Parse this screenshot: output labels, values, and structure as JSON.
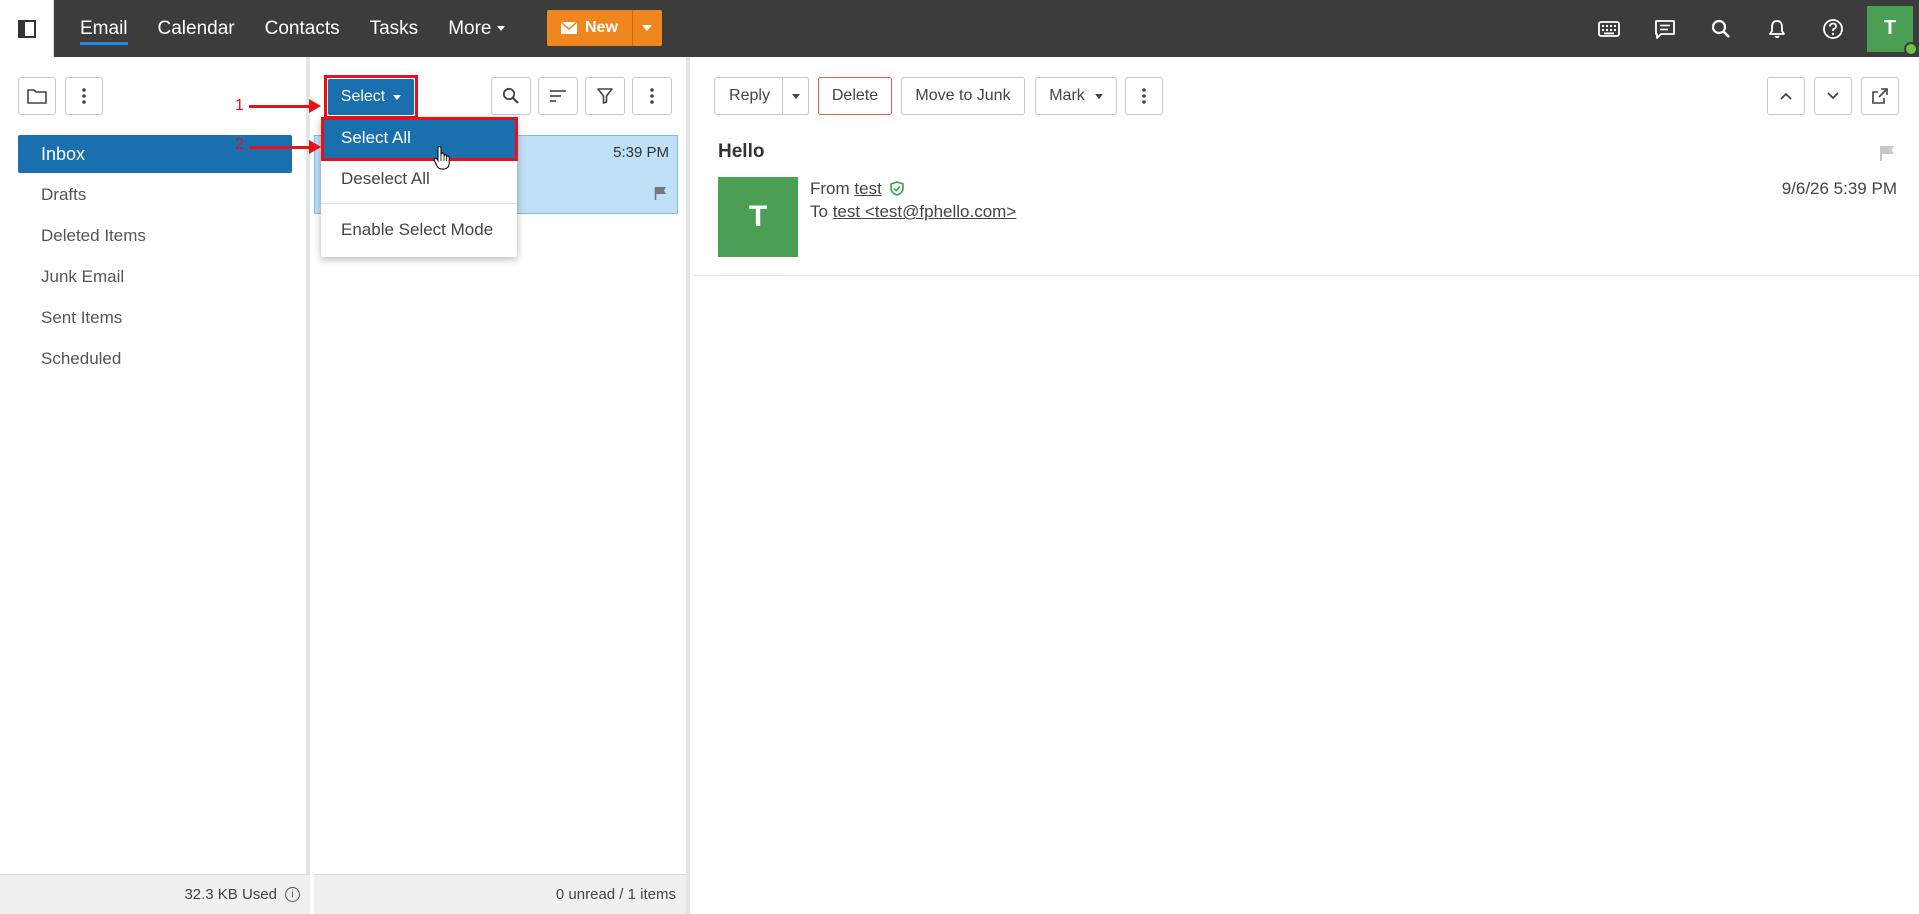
{
  "nav": {
    "items": [
      "Email",
      "Calendar",
      "Contacts",
      "Tasks",
      "More"
    ],
    "new_label": "New"
  },
  "user": {
    "initial": "T"
  },
  "folders": {
    "items": [
      "Inbox",
      "Drafts",
      "Deleted Items",
      "Junk Email",
      "Sent Items",
      "Scheduled"
    ],
    "active": "Inbox",
    "storage": "32.3 KB Used"
  },
  "message_list": {
    "select_label": "Select",
    "row_time": "5:39 PM",
    "status": "0 unread / 1 items"
  },
  "dropdown": {
    "items": [
      "Select All",
      "Deselect All",
      "Enable Select Mode"
    ]
  },
  "annotations": {
    "step1": "1",
    "step2": "2"
  },
  "reader": {
    "toolbar": {
      "reply": "Reply",
      "delete": "Delete",
      "junk": "Move to Junk",
      "mark": "Mark"
    },
    "subject": "Hello",
    "avatar_initial": "T",
    "from_label": "From",
    "from_name": "test",
    "to_label": "To",
    "to_address": "test <test@fphello.com>",
    "date": "9/6/26 5:39 PM"
  },
  "colors": {
    "topbar": "#3c3c3c",
    "accent": "#1a6faf",
    "new_button": "#f0861e",
    "avatar_green": "#4a9f55",
    "annotation_red": "#e8101a"
  }
}
